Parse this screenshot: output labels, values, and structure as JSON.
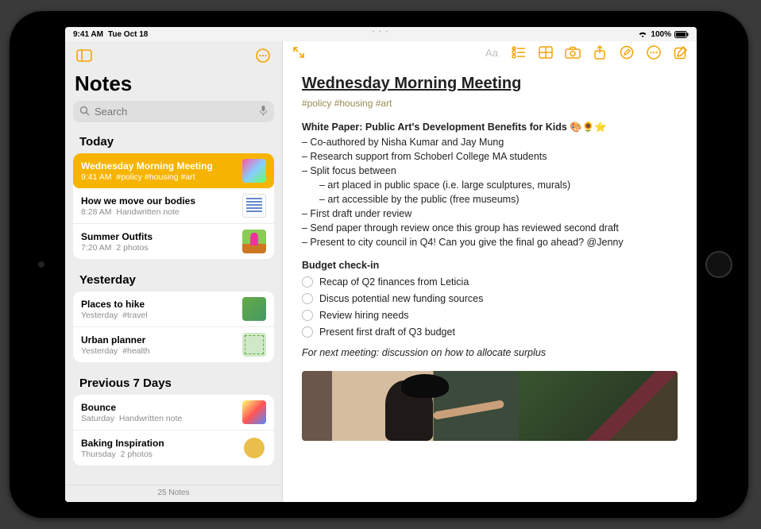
{
  "statusbar": {
    "time": "9:41 AM",
    "date": "Tue Oct 18",
    "wifi": true,
    "battery_pct": "100%"
  },
  "sidebar": {
    "title": "Notes",
    "search_placeholder": "Search",
    "sections": [
      {
        "heading": "Today",
        "notes": [
          {
            "title": "Wednesday Morning Meeting",
            "time": "9:41 AM",
            "detail": "#policy #housing #art",
            "selected": true,
            "thumb": "colorful"
          },
          {
            "title": "How we move our bodies",
            "time": "8:28 AM",
            "detail": "Handwritten note",
            "thumb": "paper"
          },
          {
            "title": "Summer Outfits",
            "time": "7:20 AM",
            "detail": "2 photos",
            "thumb": "photo"
          }
        ]
      },
      {
        "heading": "Yesterday",
        "notes": [
          {
            "title": "Places to hike",
            "time": "Yesterday",
            "detail": "#travel",
            "thumb": "green"
          },
          {
            "title": "Urban planner",
            "time": "Yesterday",
            "detail": "#health",
            "thumb": "green2"
          }
        ]
      },
      {
        "heading": "Previous 7 Days",
        "notes": [
          {
            "title": "Bounce",
            "time": "Saturday",
            "detail": "Handwritten note",
            "thumb": "bounce"
          },
          {
            "title": "Baking Inspiration",
            "time": "Thursday",
            "detail": "2 photos",
            "thumb": "bake"
          }
        ]
      }
    ],
    "footer": "25 Notes"
  },
  "toolbar": {
    "aa_label": "Aa"
  },
  "document": {
    "title": "Wednesday Morning Meeting",
    "tags": "#policy #housing #art",
    "section1_title": "White Paper: Public Art's Development Benefits for Kids 🎨🌻⭐",
    "lines": [
      "– Co-authored by Nisha Kumar and Jay Mung",
      "– Research support from Schoberl College MA students",
      "– Split focus between"
    ],
    "sublines": [
      "– art placed in public space (i.e. large sculptures, murals)",
      "– art accessible by the public (free museums)"
    ],
    "lines2": [
      "– First draft under review",
      "– Send paper through review once this group has reviewed second draft",
      "– Present to city council in Q4! Can you give the final go ahead? @Jenny"
    ],
    "section2_title": "Budget check-in",
    "checks": [
      "Recap of Q2 finances from Leticia",
      "Discus potential new funding sources",
      "Review hiring needs",
      "Present first draft of Q3 budget"
    ],
    "footnote": "For next meeting: discussion on how to allocate surplus"
  }
}
